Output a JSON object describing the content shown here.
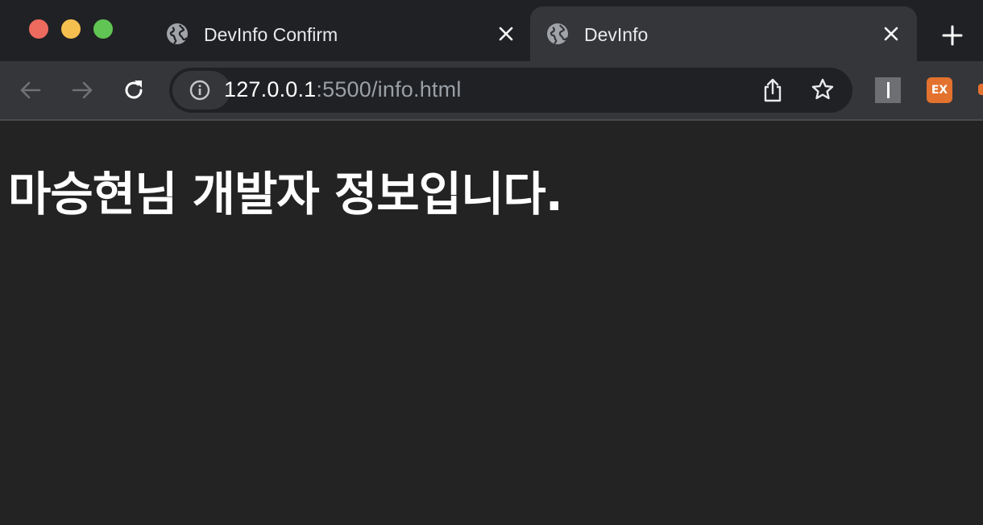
{
  "window": {
    "controls": [
      "close",
      "minimize",
      "maximize"
    ]
  },
  "tabs": [
    {
      "title": "DevInfo Confirm",
      "icon": "globe-icon",
      "active": false
    },
    {
      "title": "DevInfo",
      "icon": "globe-icon",
      "active": true
    }
  ],
  "toolbar": {
    "url_host": "127.0.0.1",
    "url_path": ":5500/info.html",
    "extensions": [
      {
        "name": "extension-1",
        "label": "I"
      },
      {
        "name": "extension-2",
        "label": "EX"
      }
    ]
  },
  "page": {
    "heading": "마승현님 개발자 정보입니다."
  },
  "colors": {
    "tabstrip": "#202124",
    "active_tab": "#35363a",
    "page_background": "#232323",
    "url_path": "#9aa0a6",
    "extension_orange": "#e2722e"
  }
}
